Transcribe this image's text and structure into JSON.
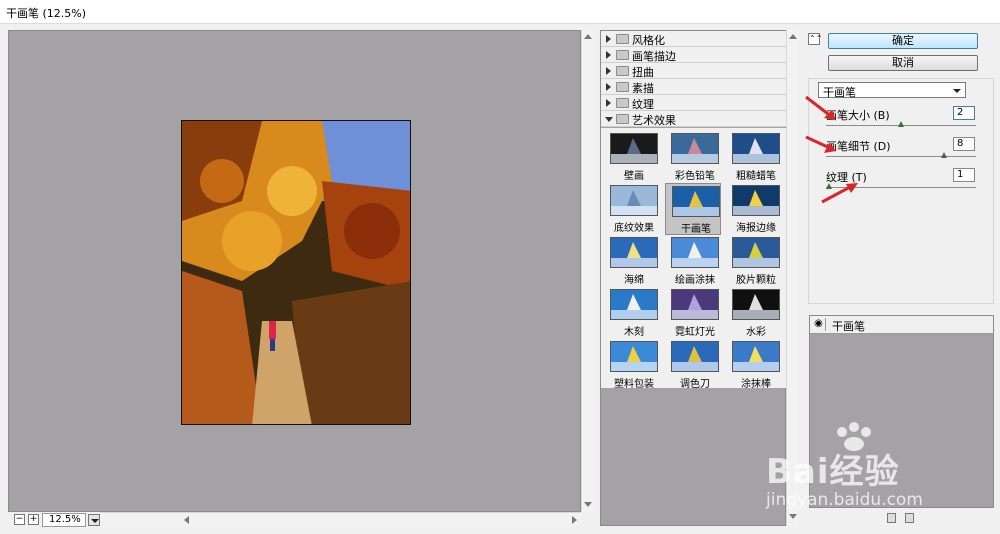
{
  "window": {
    "title": "干画笔 (12.5%)"
  },
  "preview": {
    "zoom_value": "12.5%",
    "zoom_out_symbol": "−",
    "zoom_in_symbol": "+"
  },
  "filter_gallery": {
    "categories": [
      {
        "label": "风格化",
        "expanded": false
      },
      {
        "label": "画笔描边",
        "expanded": false
      },
      {
        "label": "扭曲",
        "expanded": false
      },
      {
        "label": "素描",
        "expanded": false
      },
      {
        "label": "纹理",
        "expanded": false
      },
      {
        "label": "艺术效果",
        "expanded": true
      }
    ],
    "artistic_filters": [
      {
        "label": "壁画"
      },
      {
        "label": "彩色铅笔"
      },
      {
        "label": "粗糙蜡笔"
      },
      {
        "label": "底纹效果"
      },
      {
        "label": "干画笔",
        "selected": true
      },
      {
        "label": "海报边缘"
      },
      {
        "label": "海绵"
      },
      {
        "label": "绘画涂抹"
      },
      {
        "label": "胶片颗粒"
      },
      {
        "label": "木刻"
      },
      {
        "label": "霓虹灯光"
      },
      {
        "label": "水彩"
      },
      {
        "label": "塑料包装"
      },
      {
        "label": "调色刀"
      },
      {
        "label": "涂抹棒"
      }
    ]
  },
  "buttons": {
    "ok": "确定",
    "cancel": "取消",
    "collapse": "⌃⌃"
  },
  "settings": {
    "selected_filter": "干画笔",
    "params": [
      {
        "label": "画笔大小 (B)",
        "value": "2",
        "slider_fraction": 0.5
      },
      {
        "label": "画笔细节 (D)",
        "value": "8",
        "slider_fraction": 0.8
      },
      {
        "label": "纹理 (T)",
        "value": "1",
        "slider_fraction": 0.0
      }
    ]
  },
  "layers": {
    "items": [
      {
        "label": "干画笔",
        "visible": true
      }
    ]
  },
  "watermark": {
    "brand": "Bai经验",
    "url": "jingyan.baidu.com"
  },
  "colors": {
    "canvas_gray": "#a5a2a5",
    "annotation_red": "#d9262a",
    "ok_button": "#bee6fd"
  },
  "icons": [
    "folder-icon",
    "eye-icon",
    "new-layer-icon",
    "trash-icon",
    "chevron-icon"
  ]
}
